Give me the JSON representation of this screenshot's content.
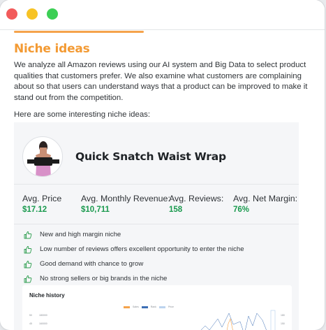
{
  "page": {
    "title": "Niche ideas",
    "intro": "We analyze all Amazon reviews using our AI system and Big Data to select product qualities that customers prefer. We also examine what customers are complaining about so that users can understand ways that a product can be improved to make it stand out from the competition.",
    "subintro": "Here are some interesting niche ideas:"
  },
  "product": {
    "name": "Quick Snatch Waist Wrap",
    "image_icon": "product-photo-waist-wrap"
  },
  "stats": [
    {
      "label": "Avg. Price",
      "value": "$17.12"
    },
    {
      "label": "Avg. Monthly Revenue:",
      "value": "$10,711"
    },
    {
      "label": "Avg. Reviews:",
      "value": "158"
    },
    {
      "label": "Avg. Net Margin:",
      "value": "76%"
    }
  ],
  "bullets": [
    "New and high margin niche",
    "Low number of reviews offers excellent opportunity to enter the niche",
    "Good demand with chance to grow",
    "No strong sellers or big brands in the niche"
  ],
  "history": {
    "title": "Niche history",
    "legend": [
      "Sales",
      "Rank",
      "Price"
    ],
    "y_left": [
      "180000",
      "160000"
    ],
    "y_left_small": [
      "50",
      "45"
    ],
    "y_right": [
      "180",
      "150"
    ]
  },
  "colors": {
    "accent": "#f39a33",
    "value_green": "#1a9a4e",
    "thumb_green": "#2e9e4f",
    "sales": "#f5a34b",
    "rank": "#3d6fb5",
    "price": "#bcd3ee"
  }
}
